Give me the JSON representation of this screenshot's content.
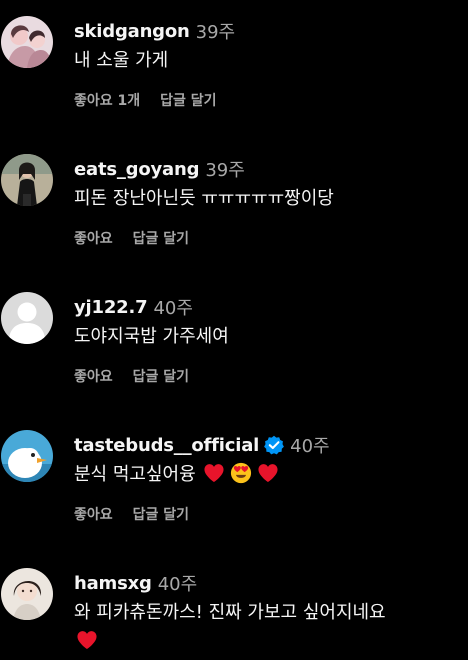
{
  "comments": [
    {
      "username": "skidgangon",
      "time": "39주",
      "text": "내 소울 가게",
      "like_label": "좋아요 1개",
      "reply_label": "답글 달기"
    },
    {
      "username": "eats_goyang",
      "time": "39주",
      "text": "피돈 장난아닌듯 ㅠㅠㅠㅠㅠ짱이당",
      "like_label": "좋아요",
      "reply_label": "답글 달기"
    },
    {
      "username": "yj122.7",
      "time": "40주",
      "text": "도야지국밥 가주세여",
      "like_label": "좋아요",
      "reply_label": "답글 달기"
    },
    {
      "username": "tastebuds__official",
      "time": "40주",
      "text": "분식 먹고싶어융",
      "like_label": "좋아요",
      "reply_label": "답글 달기",
      "verified": true,
      "emojis": [
        "red-heart",
        "heart-eyes-face",
        "red-heart"
      ]
    },
    {
      "username": "hamsxg",
      "time": "40주",
      "text": "와 피카츄돈까스! 진짜 가보고 싶어지네요",
      "emojis": [
        "red-heart"
      ]
    }
  ],
  "colors": {
    "background": "#000000",
    "primary_text": "#f5f5f5",
    "secondary_text": "#a8a8a8",
    "verified_badge": "#0095f6",
    "heart": "#e8142b"
  }
}
